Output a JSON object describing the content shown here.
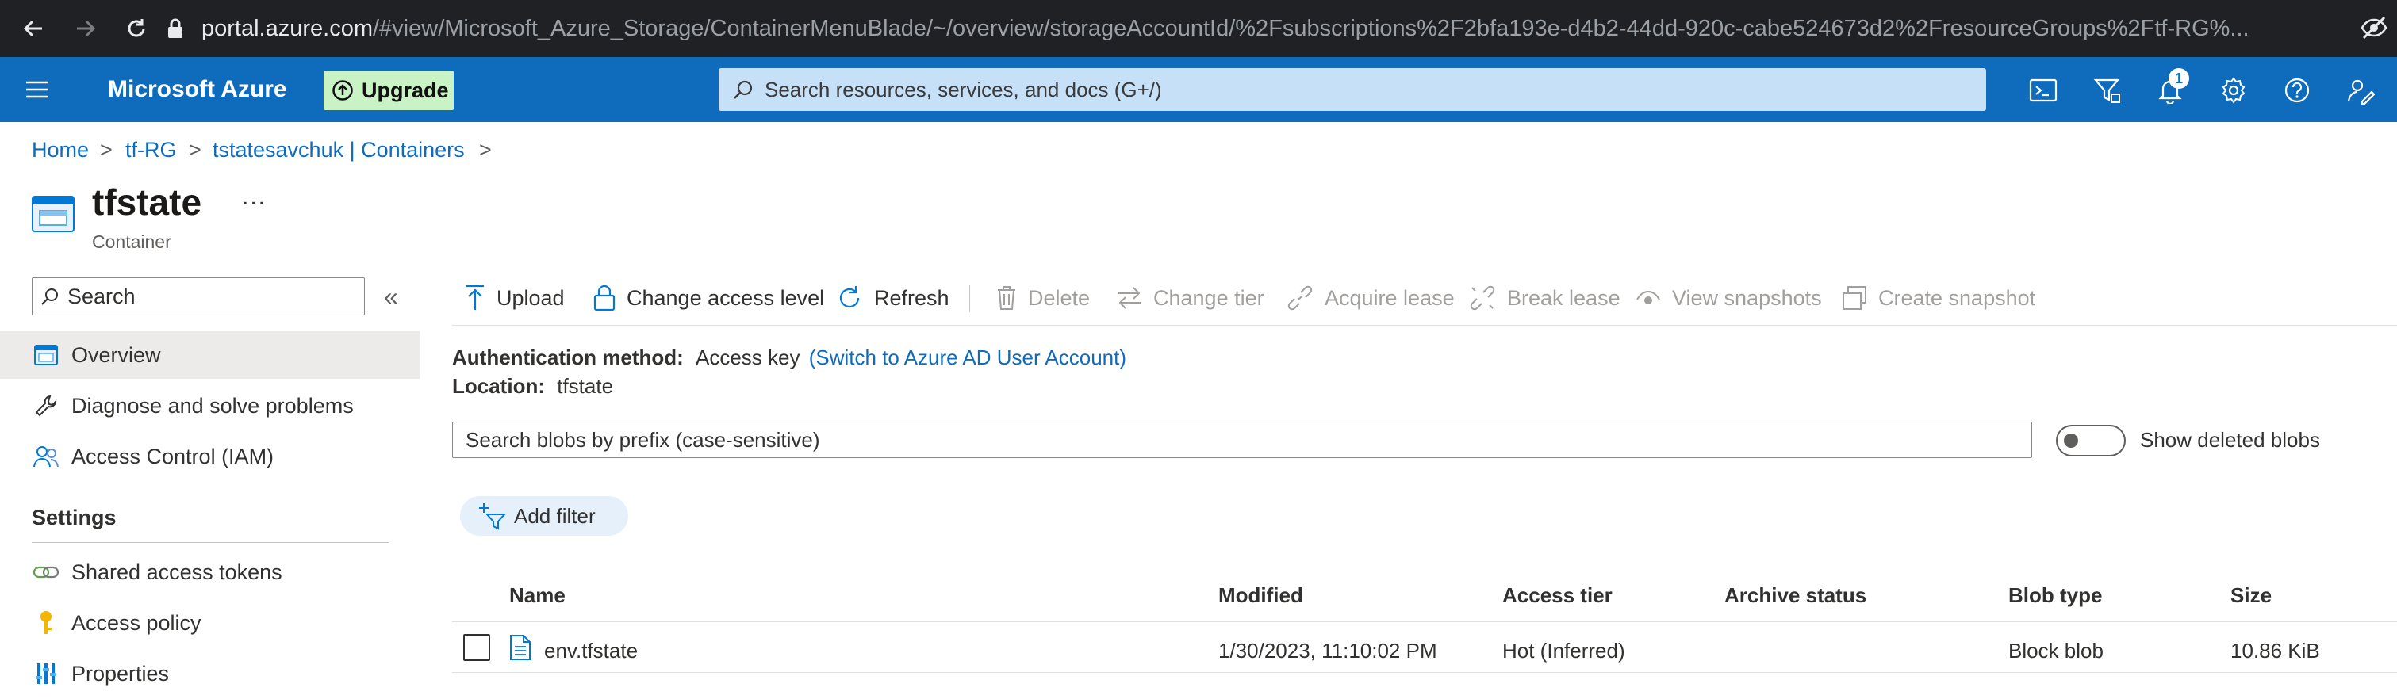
{
  "browser": {
    "url_host": "portal.azure.com",
    "url_path": "/#view/Microsoft_Azure_Storage/ContainerMenuBlade/~/overview/storageAccountId/%2Fsubscriptions%2F2bfa193e-d4b2-44dd-920c-cabe524673d2%2FresourceGroups%2Ftf-RG%..."
  },
  "topbar": {
    "brand": "Microsoft Azure",
    "upgrade_label": "Upgrade",
    "search_placeholder": "Search resources, services, and docs (G+/)",
    "notification_count": "1",
    "accent_color": "#0f6cbd"
  },
  "breadcrumb": {
    "items": [
      "Home",
      "tf-RG",
      "tstatesavchuk | Containers"
    ],
    "separator": ">"
  },
  "header": {
    "title": "tfstate",
    "subtitle": "Container",
    "more": "..."
  },
  "sidebar": {
    "search_placeholder": "Search",
    "collapse_glyph": "«",
    "items": [
      {
        "label": "Overview",
        "icon": "container-icon",
        "active": true
      },
      {
        "label": "Diagnose and solve problems",
        "icon": "wrench-icon"
      },
      {
        "label": "Access Control (IAM)",
        "icon": "people-icon"
      }
    ],
    "section_title": "Settings",
    "settings_items": [
      {
        "label": "Shared access tokens",
        "icon": "link-icon"
      },
      {
        "label": "Access policy",
        "icon": "key-icon"
      },
      {
        "label": "Properties",
        "icon": "properties-icon"
      }
    ]
  },
  "toolbar": {
    "upload": "Upload",
    "change_access_level": "Change access level",
    "refresh": "Refresh",
    "delete": "Delete",
    "change_tier": "Change tier",
    "acquire_lease": "Acquire lease",
    "break_lease": "Break lease",
    "view_snapshots": "View snapshots",
    "create_snapshot": "Create snapshot"
  },
  "info": {
    "auth_label": "Authentication method:",
    "auth_value": "Access key",
    "auth_link": "(Switch to Azure AD User Account)",
    "location_label": "Location:",
    "location_value": "tfstate"
  },
  "blob_search": {
    "placeholder": "Search blobs by prefix (case-sensitive)",
    "show_deleted_label": "Show deleted blobs"
  },
  "filter": {
    "add_filter_label": "Add filter"
  },
  "table": {
    "columns": [
      "Name",
      "Modified",
      "Access tier",
      "Archive status",
      "Blob type",
      "Size"
    ],
    "rows": [
      {
        "name": "env.tfstate",
        "modified": "1/30/2023, 11:10:02 PM",
        "access_tier": "Hot (Inferred)",
        "archive_status": "",
        "blob_type": "Block blob",
        "size": "10.86 KiB"
      }
    ]
  }
}
